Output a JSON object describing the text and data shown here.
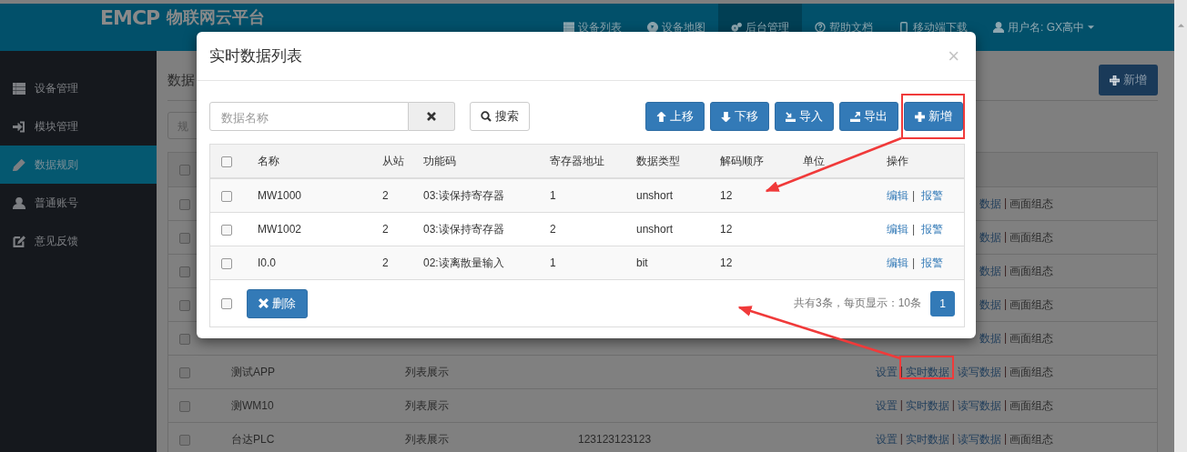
{
  "header": {
    "logo": "EMCP",
    "title": "物联网云平台",
    "nav": [
      {
        "label": "设备列表",
        "kind": "list",
        "selected": false
      },
      {
        "label": "设备地图",
        "kind": "globe",
        "selected": false
      },
      {
        "label": "后台管理",
        "kind": "gears",
        "selected": true
      },
      {
        "label": "帮助文档",
        "kind": "question",
        "selected": false
      },
      {
        "label": "移动端下载",
        "kind": "phone",
        "selected": false
      },
      {
        "label": "用户名: GX高中",
        "kind": "user",
        "selected": false
      }
    ]
  },
  "sidebar": {
    "items": [
      {
        "label": "设备管理",
        "kind": "list",
        "selected": false
      },
      {
        "label": "模块管理",
        "kind": "signin",
        "selected": false
      },
      {
        "label": "数据规则",
        "kind": "pencil",
        "selected": true
      },
      {
        "label": "普通账号",
        "kind": "user",
        "selected": false
      },
      {
        "label": "意见反馈",
        "kind": "edit",
        "selected": false
      }
    ]
  },
  "page": {
    "title": "数据",
    "add_button": "新增",
    "filter_placeholder": "规",
    "separator": "|",
    "table": {
      "header_checked": false,
      "rows": [
        {
          "checked": false,
          "actions": [
            "数据",
            "画面组态"
          ]
        },
        {
          "checked": false,
          "actions": [
            "数据",
            "画面组态"
          ]
        },
        {
          "checked": false,
          "actions": [
            "数据",
            "画面组态"
          ]
        },
        {
          "checked": false,
          "actions": [
            "数据",
            "画面组态"
          ]
        },
        {
          "checked": false,
          "actions": [
            "数据",
            "画面组态"
          ]
        },
        {
          "checked": false,
          "name": "测试APP",
          "display": "列表展示",
          "actions": [
            "设置",
            "实时数据",
            "读写数据",
            "画面组态"
          ]
        },
        {
          "checked": false,
          "name": "测WM10",
          "display": "列表展示",
          "actions": [
            "设置",
            "实时数据",
            "读写数据",
            "画面组态"
          ]
        },
        {
          "checked": false,
          "name": "台达PLC",
          "display": "列表展示",
          "address": "123123123123",
          "actions": [
            "设置",
            "实时数据",
            "读写数据",
            "画面组态"
          ]
        }
      ]
    }
  },
  "modal": {
    "title": "实时数据列表",
    "close": "×",
    "search_placeholder": "数据名称",
    "search_button": "搜索",
    "toolbar": [
      {
        "label": "上移",
        "kind": "up"
      },
      {
        "label": "下移",
        "kind": "down"
      },
      {
        "label": "导入",
        "kind": "import"
      },
      {
        "label": "导出",
        "kind": "export"
      },
      {
        "label": "新增",
        "kind": "plus"
      }
    ],
    "columns": [
      "名称",
      "从站",
      "功能码",
      "寄存器地址",
      "数据类型",
      "解码顺序",
      "单位",
      "操作"
    ],
    "header_checked": false,
    "separator": "|",
    "rows": [
      {
        "checked": false,
        "cells": [
          "MW1000",
          "2",
          "03:读保持寄存器",
          "1",
          "unshort",
          "12",
          ""
        ],
        "actions": [
          "编辑",
          "报警"
        ]
      },
      {
        "checked": false,
        "cells": [
          "MW1002",
          "2",
          "03:读保持寄存器",
          "2",
          "unshort",
          "12",
          ""
        ],
        "actions": [
          "编辑",
          "报警"
        ]
      },
      {
        "checked": false,
        "cells": [
          "I0.0",
          "2",
          "02:读离散量输入",
          "1",
          "bit",
          "12",
          ""
        ],
        "actions": [
          "编辑",
          "报警"
        ]
      }
    ],
    "footer_checked": false,
    "delete_button": "删除",
    "summary": "共有3条，每页显示：10条",
    "pages": [
      {
        "label": "1",
        "selected": true
      }
    ]
  }
}
